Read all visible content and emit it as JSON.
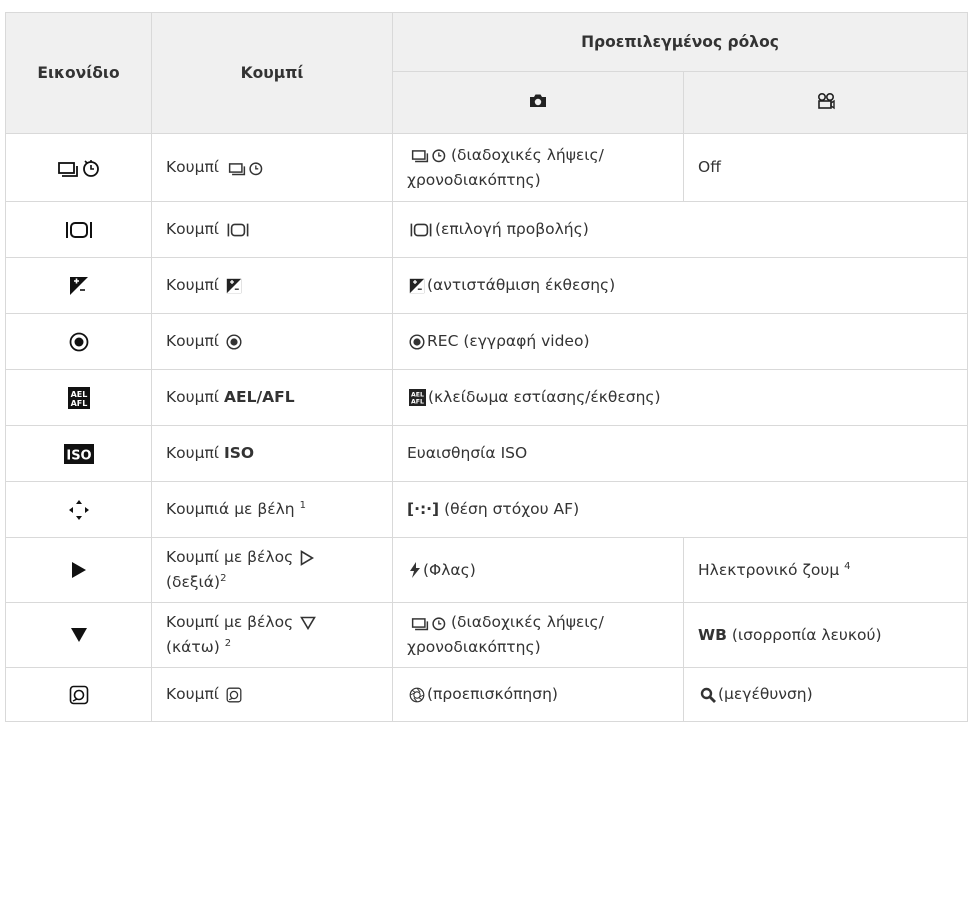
{
  "table": {
    "headers": {
      "icon": "Εικονίδιο",
      "button": "Κουμπί",
      "default_role": "Προεπιλεγμένος ρόλος",
      "photo_icon": "camera-icon",
      "video_icon": "movie-icon"
    },
    "rows": [
      {
        "icon": "drive-self-timer-icon",
        "button": "Κουμπί",
        "photo_l1": "(διαδοχικές λήψεις/",
        "photo_l2": "χρονοδιακόπτης)",
        "video": "Off"
      },
      {
        "icon": "lv-display-icon",
        "button": "Κουμπί",
        "photo": "(επιλογή προβολής)"
      },
      {
        "icon": "exposure-comp-icon",
        "button": "Κουμπί",
        "photo": "(αντιστάθμιση έκθεσης)"
      },
      {
        "icon": "rec-icon",
        "button": "Κουμπί",
        "photo": "REC (εγγραφή video)"
      },
      {
        "icon": "ael-afl-icon",
        "button": "Κουμπί",
        "button_bold": "AEL/AFL",
        "photo": "(κλείδωμα εστίασης/έκθεσης)"
      },
      {
        "icon": "iso-icon",
        "button": "Κουμπί",
        "button_bold": "ISO",
        "photo": "Ευαισθησία ISO"
      },
      {
        "icon": "arrow-pad-icon",
        "button": "Κουμπιά με βέλη",
        "button_sup": "1",
        "photo_prefix": "[·:·]",
        "photo": "(θέση στόχου AF)"
      },
      {
        "icon": "arrow-right-icon",
        "button_l1": "Κουμπί με βέλος",
        "button_l2": "(δεξιά)",
        "button_sup": "2",
        "photo": "(Φλας)",
        "video": "Ηλεκτρονικό ζουμ",
        "video_sup": "4"
      },
      {
        "icon": "arrow-down-icon",
        "button_l1": "Κουμπί με βέλος",
        "button_l2": "(κάτω)",
        "button_sup": "2",
        "photo_l1": "(διαδοχικές λήψεις/",
        "photo_l2": "χρονοδιακόπτης)",
        "video_bold": "WB",
        "video": "(ισορροπία λευκού)"
      },
      {
        "icon": "preview-button-icon",
        "button": "Κουμπί",
        "photo": "(προεπισκόπηση)",
        "video": "(μεγέθυνση)"
      }
    ]
  }
}
